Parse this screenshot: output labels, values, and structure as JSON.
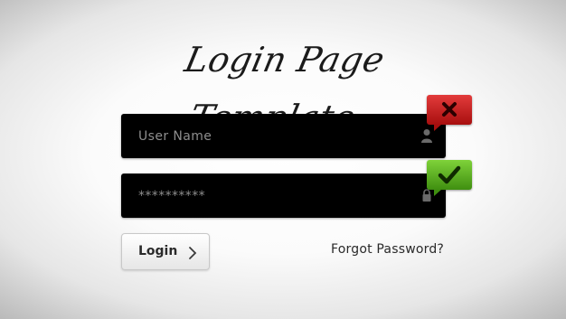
{
  "header": {
    "title": "Login Page Template"
  },
  "form": {
    "username": {
      "placeholder": "User Name",
      "icon": "user-icon",
      "status": "error"
    },
    "password": {
      "value": "**********",
      "icon": "lock-icon",
      "status": "valid"
    },
    "login_button": {
      "label": "Login",
      "icon": "chevron-right-icon"
    },
    "forgot_link": "Forgot Password?"
  },
  "colors": {
    "field_bg": "#000000",
    "error_badge": "#c21f1f",
    "ok_badge": "#5cb324",
    "text": "#2a2a2a"
  }
}
